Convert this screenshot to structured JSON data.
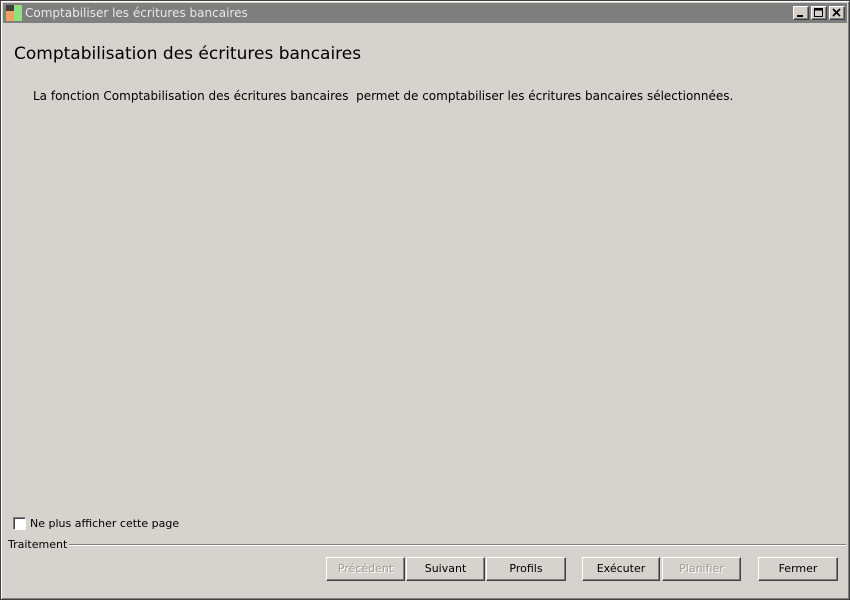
{
  "window": {
    "title": "Comptabiliser les écritures bancaires",
    "controls": [
      "minimize-icon",
      "maximize-icon",
      "close-icon"
    ]
  },
  "page": {
    "title": "Comptabilisation des écritures bancaires",
    "description": "La fonction Comptabilisation des écritures bancaires  permet de comptabiliser les écritures bancaires sélectionnées."
  },
  "options": {
    "hide_page_label": "Ne plus afficher cette page",
    "hide_page_checked": false
  },
  "footer": {
    "group_label": "Traitement",
    "buttons": {
      "previous": "Précédent",
      "next": "Suivant",
      "profiles": "Profils",
      "execute": "Exécuter",
      "schedule": "Planifier",
      "close": "Fermer"
    }
  }
}
